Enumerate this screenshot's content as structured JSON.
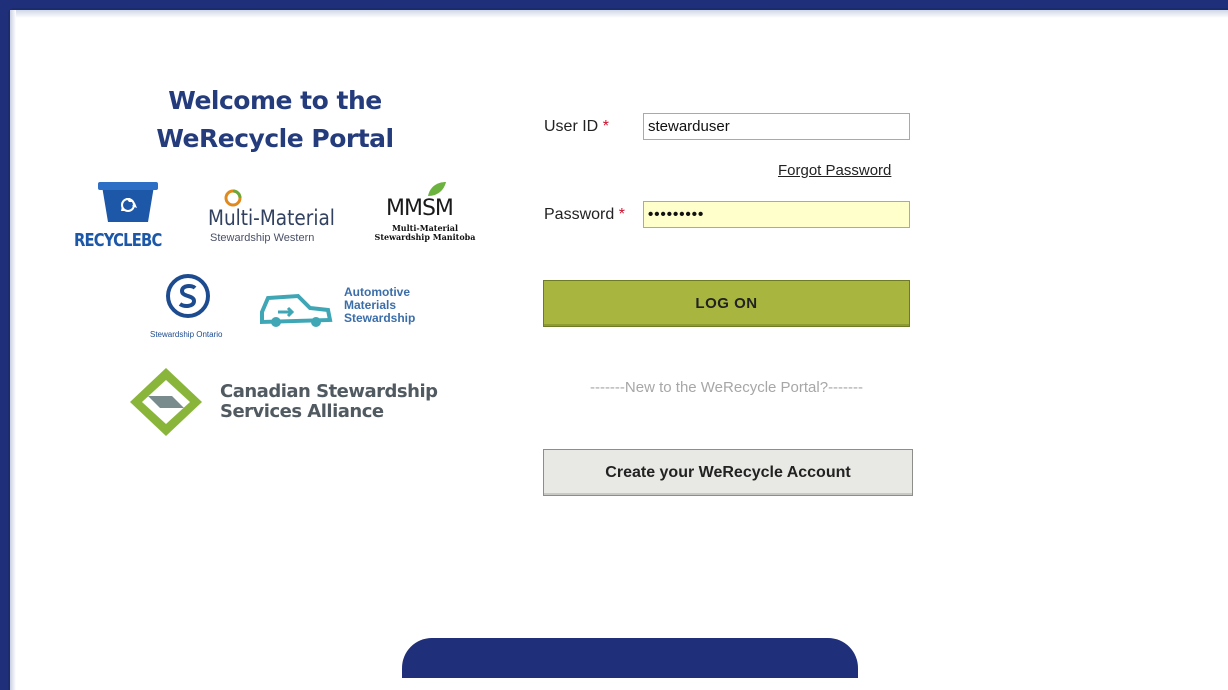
{
  "welcome": {
    "line1": "Welcome to the",
    "line2": "WeRecycle Portal"
  },
  "logos": {
    "recyclebc": {
      "name": "RECYCLEBC",
      "icon": "recycle-bin-icon"
    },
    "mmsw": {
      "name": "Multi-Material",
      "sub": "Stewardship Western"
    },
    "mmsm": {
      "name": "MMSM",
      "sub1": "Multi-Material",
      "sub2": "Stewardship Manitoba"
    },
    "so": {
      "caption": "Stewardship Ontario"
    },
    "ams": {
      "line1": "Automotive",
      "line2": "Materials",
      "line3": "Stewardship"
    },
    "csa": {
      "line1": "Canadian Stewardship",
      "line2": "Services Alliance"
    }
  },
  "form": {
    "userid_label": "User ID",
    "userid_value": "stewarduser",
    "required_mark": "*",
    "forgot_label": "Forgot Password",
    "password_label": "Password",
    "password_value": "•••••••••",
    "logon_label": "LOG ON",
    "new_to_text": "-------New to the WeRecycle Portal?-------",
    "create_label": "Create your WeRecycle Account"
  },
  "colors": {
    "brand_navy": "#1f2f7a",
    "logon_green": "#a8b640",
    "password_bg": "#ffffcc",
    "required_red": "#c8102e"
  }
}
